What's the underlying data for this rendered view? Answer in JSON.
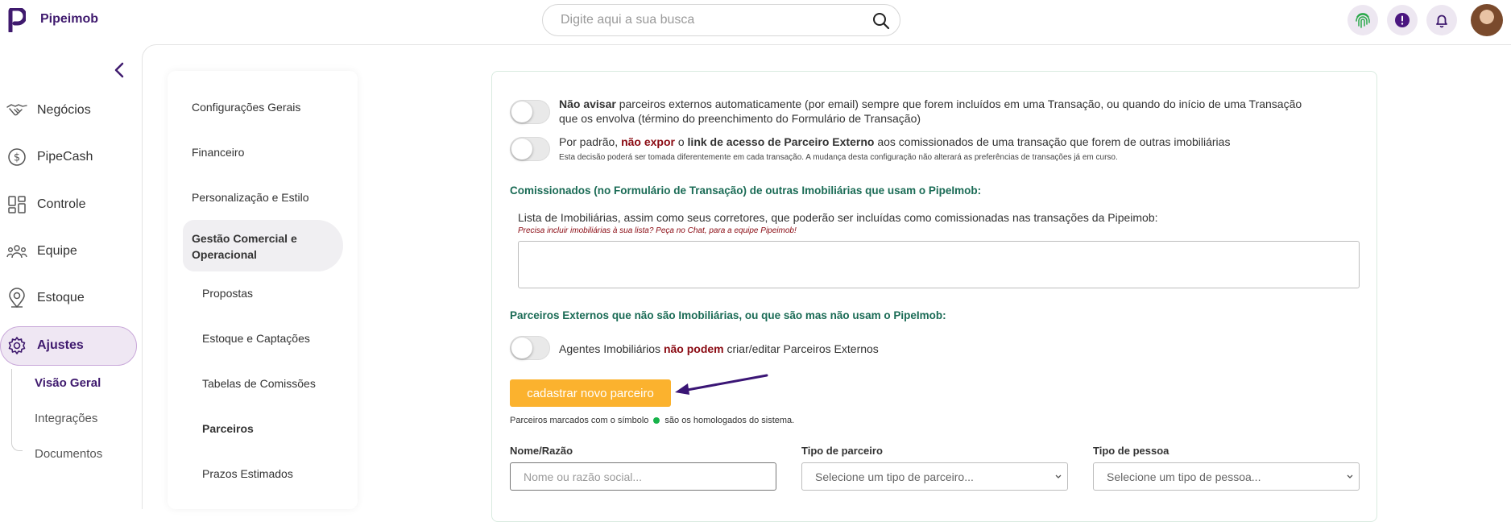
{
  "app": {
    "brand": "Pipeimob"
  },
  "search": {
    "placeholder": "Digite aqui a sua busca"
  },
  "sidebar": {
    "items": [
      {
        "label": "Negócios"
      },
      {
        "label": "PipeCash"
      },
      {
        "label": "Controle"
      },
      {
        "label": "Equipe"
      },
      {
        "label": "Estoque"
      },
      {
        "label": "Ajustes"
      }
    ],
    "subitems": [
      {
        "label": "Visão Geral"
      },
      {
        "label": "Integrações"
      },
      {
        "label": "Documentos"
      }
    ]
  },
  "settings_menu": {
    "items": [
      {
        "label": "Configurações Gerais"
      },
      {
        "label": "Financeiro"
      },
      {
        "label": "Personalização e Estilo"
      },
      {
        "label": "Gestão Comercial e Operacional"
      }
    ],
    "subitems": [
      {
        "label": "Propostas"
      },
      {
        "label": "Estoque e Captações"
      },
      {
        "label": "Tabelas de Comissões"
      },
      {
        "label": "Parceiros"
      },
      {
        "label": "Prazos Estimados"
      }
    ]
  },
  "panel": {
    "toggle1": {
      "bold": "Não avisar",
      "rest_line1": " parceiros externos automaticamente (por email) sempre que forem incluídos em uma Transação, ou quando do início de uma Transação",
      "line2": "que os envolva (término do preenchimento do Formulário de Transação)"
    },
    "toggle2": {
      "pre": "Por padrão, ",
      "red": "não expor",
      "mid": " o ",
      "bold": "link de acesso de Parceiro Externo",
      "post": " aos comissionados de uma transação que forem de outras imobiliárias",
      "note": "Esta decisão poderá ser tomada diferentemente em cada transação. A mudança desta configuração não alterará as preferências de transações já em curso."
    },
    "section1": {
      "title": "Comissionados (no Formulário de Transação) de outras Imobiliárias que usam o PipeImob:",
      "desc": "Lista de Imobiliárias, assim como seus corretores, que poderão ser incluídas como comissionadas nas transações da Pipeimob:",
      "hint": "Precisa incluir imobiliárias à sua lista? Peça no Chat, para a equipe Pipeimob!"
    },
    "section2": {
      "title": "Parceiros Externos que não são Imobiliárias, ou que são mas não usam o PipeImob:",
      "toggle_pre": "Agentes Imobiliários ",
      "toggle_red": "não podem",
      "toggle_post": " criar/editar Parceiros Externos",
      "button": "cadastrar novo parceiro",
      "note_pre": "Parceiros marcados com o símbolo",
      "note_post": "são os homologados do sistema."
    },
    "filters": {
      "name_label": "Nome/Razão",
      "name_placeholder": "Nome ou razão social...",
      "type_label": "Tipo de parceiro",
      "type_value": "Selecione um tipo de parceiro...",
      "person_label": "Tipo de pessoa",
      "person_value": "Selecione um tipo de pessoa..."
    }
  },
  "colors": {
    "brand": "#3f1a6e",
    "accent_button": "#fbb22e",
    "section_title": "#1a6b55",
    "emphasis_red": "#8a0a12",
    "homologated_dot": "#17b34a"
  }
}
